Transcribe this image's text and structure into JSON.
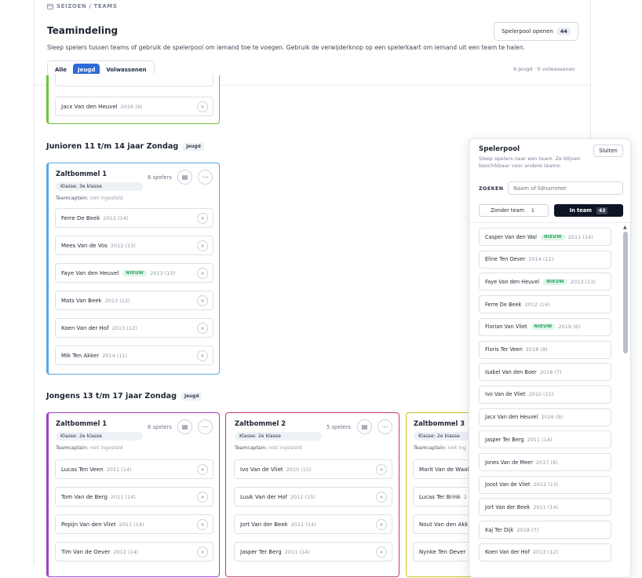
{
  "breadcrumb": "SEIZOEN / TEAMS",
  "page": {
    "title": "Teamindeling",
    "description": "Sleep spelers tussen teams of gebruik de spelerpool om iemand toe te voegen. Gebruik de verwijderknop op een spelerkaart om iemand uit een team te halen.",
    "filters": [
      "Alle",
      "Jeugd",
      "Volwassenen"
    ],
    "active_filter": "Jeugd",
    "pool_button": "Spelerpool openen",
    "pool_count": "44",
    "summary": "9 jeugd · 0 volwassenen"
  },
  "top_team": {
    "player": {
      "name": "Jacx Van den Heuvel",
      "year": "2016 (9)"
    },
    "color": "#6cc43a"
  },
  "groups": [
    {
      "title": "Junioren 11 t/m 14 jaar Zondag",
      "tag": "Jeugd"
    },
    {
      "title": "Jongens 13 t/m 17 jaar Zondag",
      "tag": "Jeugd"
    }
  ],
  "team_j1": {
    "name": "Zaltbommel 1",
    "count": "6 spelers",
    "klasse": "Klasse: 3e klasse",
    "captain": "Teamcaptain:",
    "captain_val": "niet ingesteld",
    "color": "#5aa8e6",
    "players": [
      {
        "name": "Ferre De Beek",
        "year": "2012 (14)",
        "nieuw": ""
      },
      {
        "name": "Mees Van de Vos",
        "year": "2012 (13)",
        "nieuw": ""
      },
      {
        "name": "Faye Van den Heuvel",
        "year": "2013 (13)",
        "nieuw": "NIEUW"
      },
      {
        "name": "Mats Van Beek",
        "year": "2013 (12)",
        "nieuw": ""
      },
      {
        "name": "Koen Van der Hof",
        "year": "2013 (12)",
        "nieuw": ""
      },
      {
        "name": "Mik Ten Akker",
        "year": "2014 (11)",
        "nieuw": ""
      }
    ]
  },
  "team_g1": {
    "name": "Zaltbommel 1",
    "count": "6 spelers",
    "klasse": "Klasse: 2e klasse",
    "captain": "Teamcaptain:",
    "captain_val": "niet ingesteld",
    "color": "#a23fc6",
    "players": [
      {
        "name": "Lucas Ten Veen",
        "year": "2011 (14)"
      },
      {
        "name": "Tom Van de Berg",
        "year": "2011 (14)"
      },
      {
        "name": "Pepijn Van den Vliet",
        "year": "2011 (14)"
      },
      {
        "name": "Tim Van de Oever",
        "year": "2012 (14)"
      }
    ]
  },
  "team_g2": {
    "name": "Zaltbommel 2",
    "count": "5 spelers",
    "klasse": "Klasse: 2e klasse",
    "captain": "Teamcaptain:",
    "captain_val": "niet ingesteld",
    "color": "#c23a6a",
    "players": [
      {
        "name": "Ivo Van de Vliet",
        "year": "2010 (15)"
      },
      {
        "name": "Luuk Van der Hof",
        "year": "2011 (15)"
      },
      {
        "name": "Jort Van der Beek",
        "year": "2011 (14)"
      },
      {
        "name": "Jasper Ter Berg",
        "year": "2011 (14)"
      }
    ]
  },
  "team_g3": {
    "name": "Zaltbommel 3",
    "klasse": "Klasse: 2e klasse",
    "captain": "Teamcaptain:",
    "captain_val": "niet ing",
    "color": "#c9c020",
    "players": [
      {
        "name": "Marit Van de Waal"
      },
      {
        "name": "Lucas Ter Brink",
        "year": "2"
      },
      {
        "name": "Nout Van den Akk"
      },
      {
        "name": "Nynke Ten Oever"
      }
    ]
  },
  "pool": {
    "title": "Spelerpool",
    "subtitle": "Sleep spelers naar een team. Ze blijven beschikbaar voor andere teams.",
    "close": "Sluiten",
    "search_label": "ZOEKEN",
    "search_placeholder": "Naam of lidnummer",
    "tab_without": "Zonder team",
    "tab_without_count": "1",
    "tab_in": "In team",
    "tab_in_count": "43",
    "players": [
      {
        "name": "Casper Van den Wal",
        "nieuw": "NIEUW",
        "year": "2011 (14)"
      },
      {
        "name": "Eline Ten Oever",
        "nieuw": "",
        "year": "2014 (11)"
      },
      {
        "name": "Faye Van den Heuvel",
        "nieuw": "NIEUW",
        "year": "2013 (13)"
      },
      {
        "name": "Ferre De Beek",
        "nieuw": "",
        "year": "2012 (14)"
      },
      {
        "name": "Florian Van Vliet",
        "nieuw": "NIEUW",
        "year": "2019 (6)"
      },
      {
        "name": "Floris Ter Veen",
        "nieuw": "",
        "year": "2018 (8)"
      },
      {
        "name": "Isabel Van den Boer",
        "nieuw": "",
        "year": "2018 (7)"
      },
      {
        "name": "Ivo Van de Vliet",
        "nieuw": "",
        "year": "2010 (15)"
      },
      {
        "name": "Jacx Van den Heuvel",
        "nieuw": "",
        "year": "2016 (9)"
      },
      {
        "name": "Jasper Ter Berg",
        "nieuw": "",
        "year": "2011 (14)"
      },
      {
        "name": "Jones Van de Meer",
        "nieuw": "",
        "year": "2017 (8)"
      },
      {
        "name": "Joost Van de Vliet",
        "nieuw": "",
        "year": "2012 (13)"
      },
      {
        "name": "Jort Van der Beek",
        "nieuw": "",
        "year": "2011 (14)"
      },
      {
        "name": "Kaj Ter Dijk",
        "nieuw": "",
        "year": "2018 (7)"
      },
      {
        "name": "Koen Van der Hof",
        "nieuw": "",
        "year": "2013 (12)"
      }
    ]
  }
}
